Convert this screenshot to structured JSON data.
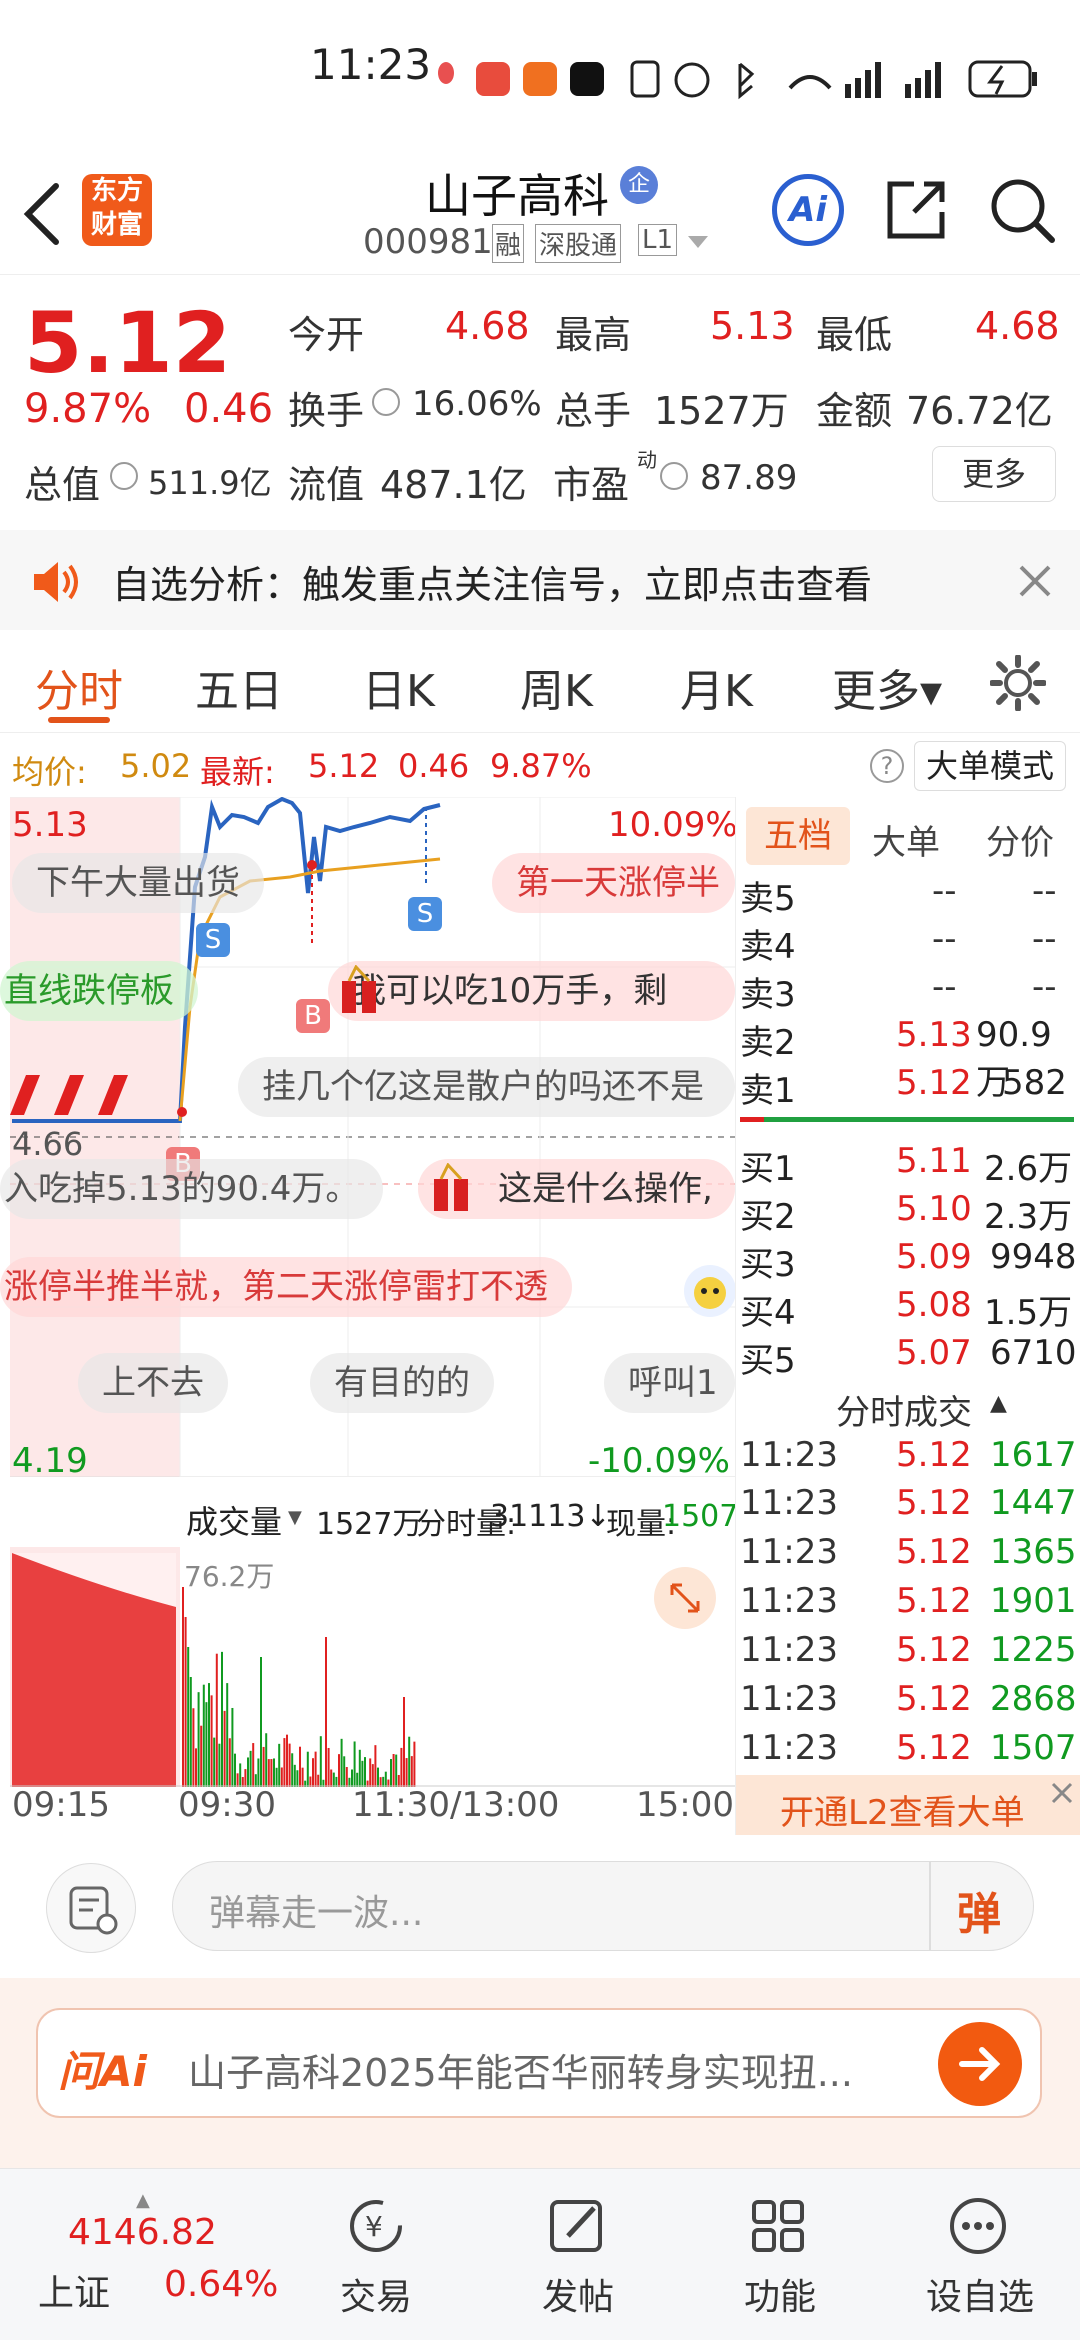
{
  "status_bar": {
    "time": "11:23"
  },
  "header": {
    "logo_text_1": "东方",
    "logo_text_2": "财富",
    "title": "山子高科",
    "badge": "企",
    "code": "000981",
    "tags": [
      "融",
      "深股通",
      "L1"
    ],
    "ai_label": "Ai"
  },
  "quote": {
    "price": "5.12",
    "pct": "9.87%",
    "change": "0.46",
    "fields": [
      {
        "label": "今开",
        "value": "4.68"
      },
      {
        "label": "最高",
        "value": "5.13"
      },
      {
        "label": "最低",
        "value": "4.68"
      },
      {
        "label": "换手",
        "value": "16.06%"
      },
      {
        "label": "总手",
        "value": "1527万"
      },
      {
        "label": "金额",
        "value": "76.72亿"
      },
      {
        "label": "总值",
        "value": "511.9亿"
      },
      {
        "label": "流值",
        "value": "487.1亿"
      },
      {
        "label": "市盈",
        "sup": "动",
        "value": "87.89"
      }
    ],
    "more_button": "更多"
  },
  "banner": {
    "text": "自选分析：触发重点关注信号，立即点击查看"
  },
  "tabs": [
    {
      "label": "分时",
      "active": true
    },
    {
      "label": "五日"
    },
    {
      "label": "日K"
    },
    {
      "label": "周K"
    },
    {
      "label": "月K"
    },
    {
      "label": "更多▾"
    }
  ],
  "chart_info": {
    "avg_label": "均价:",
    "avg_value": "5.02",
    "latest_label": "最新:",
    "latest_value": "5.12",
    "latest_change": "0.46",
    "latest_pct": "9.87%",
    "mode_button": "大单模式",
    "y_top": "5.13",
    "y_mid": "4.66",
    "y_bottom": "4.19",
    "pct_top": "10.09%",
    "pct_bottom": "-10.09%",
    "b_marker": "B",
    "s_marker": "S"
  },
  "danmu": [
    "下午大量出货",
    "第一天涨停半",
    "直线跌停板",
    "我可以吃10万手，剩",
    "挂几个亿这是散户的吗还不是",
    "入吃掉5.13的90.4万。",
    "这是什么操作,",
    "涨停半推半就，第二天涨停雷打不透",
    "上不去",
    "有目的的",
    "呼叫1"
  ],
  "volume": {
    "selector": "成交量",
    "total": "1527万",
    "fen_label": "分时量:",
    "fen_value": "31113↓",
    "now_label": "现量:",
    "now_value": "1507",
    "peak": "76.2万"
  },
  "time_axis": [
    "09:15",
    "09:30",
    "11:30/13:00",
    "15:00"
  ],
  "orderbook": {
    "tabs": [
      "五档",
      "大单",
      "分价"
    ],
    "sells": [
      {
        "label": "卖5",
        "price": "--",
        "vol": "--"
      },
      {
        "label": "卖4",
        "price": "--",
        "vol": "--"
      },
      {
        "label": "卖3",
        "price": "--",
        "vol": "--"
      },
      {
        "label": "卖2",
        "price": "5.13",
        "vol": "90.9万"
      },
      {
        "label": "卖1",
        "price": "5.12",
        "vol": "582"
      }
    ],
    "buys": [
      {
        "label": "买1",
        "price": "5.11",
        "vol": "2.6万"
      },
      {
        "label": "买2",
        "price": "5.10",
        "vol": "2.3万"
      },
      {
        "label": "买3",
        "price": "5.09",
        "vol": "9948"
      },
      {
        "label": "买4",
        "price": "5.08",
        "vol": "1.5万"
      },
      {
        "label": "买5",
        "price": "5.07",
        "vol": "6710"
      }
    ],
    "trades_title": "分时成交",
    "trades": [
      {
        "time": "11:23",
        "price": "5.12",
        "vol": "1617"
      },
      {
        "time": "11:23",
        "price": "5.12",
        "vol": "1447"
      },
      {
        "time": "11:23",
        "price": "5.12",
        "vol": "1365"
      },
      {
        "time": "11:23",
        "price": "5.12",
        "vol": "1901"
      },
      {
        "time": "11:23",
        "price": "5.12",
        "vol": "1225"
      },
      {
        "time": "11:23",
        "price": "5.12",
        "vol": "2868"
      },
      {
        "time": "11:23",
        "price": "5.12",
        "vol": "1507"
      }
    ],
    "l2_promo": "开通L2查看大单"
  },
  "input": {
    "placeholder": "弹幕走一波...",
    "send_label": "弹"
  },
  "ai_bar": {
    "logo": "问Ai",
    "text": "山子高科2025年能否华丽转身实现扭..."
  },
  "nav": {
    "index_value": "4146.82",
    "index_name": "上证",
    "index_pct": "0.64%",
    "items": [
      "交易",
      "发帖",
      "功能",
      "设自选"
    ]
  },
  "colors": {
    "up": "#e02020",
    "down": "#109a20",
    "accent": "#f05a1a",
    "price_line": "#2a64c0",
    "avg_line": "#e8a020"
  }
}
